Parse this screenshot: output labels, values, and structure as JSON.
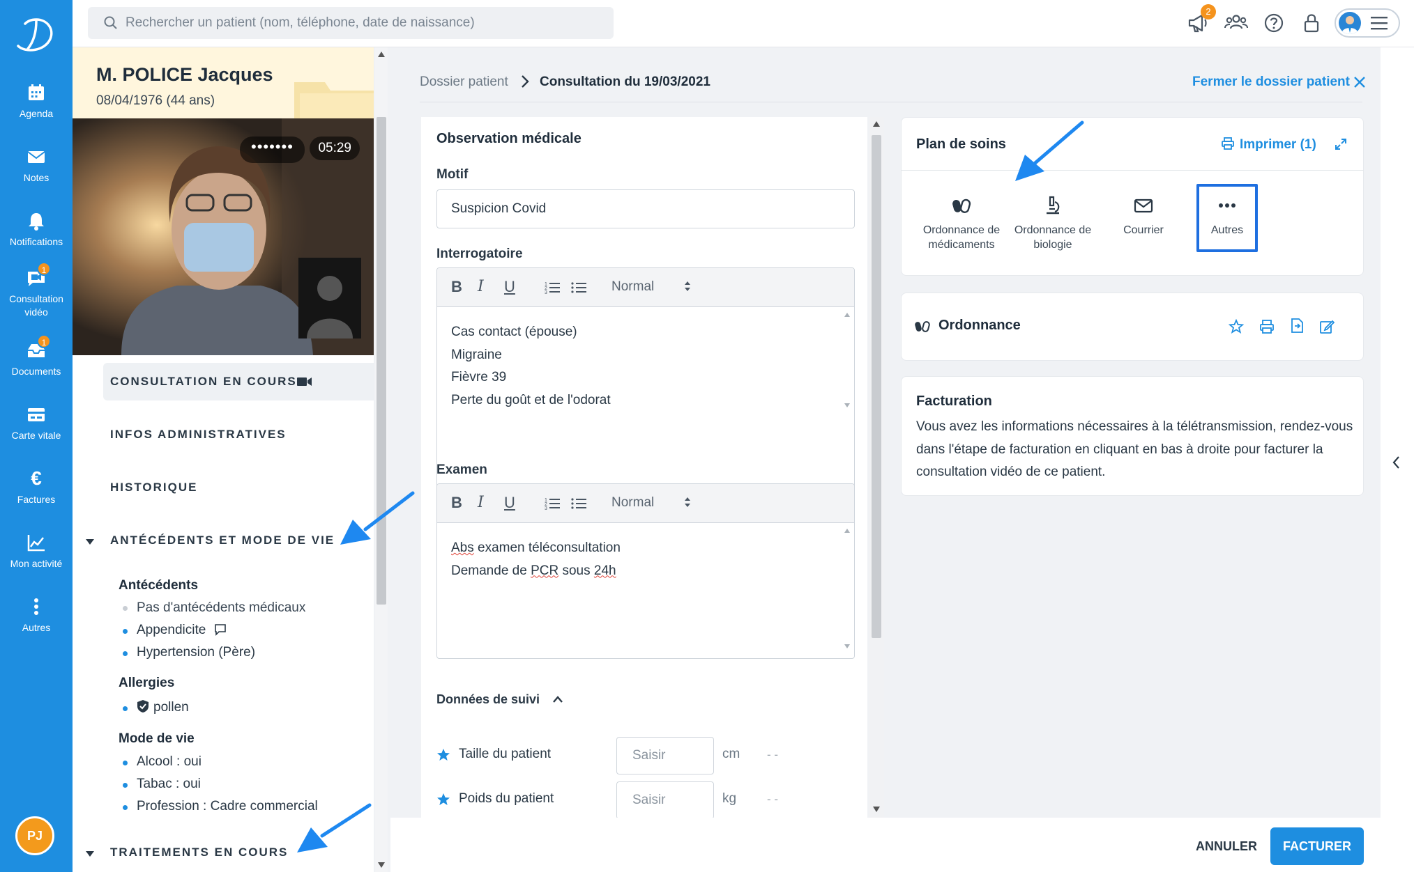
{
  "nav": {
    "items": [
      {
        "label": "Agenda",
        "icon": "calendar-icon"
      },
      {
        "label": "Notes",
        "icon": "envelope-icon"
      },
      {
        "label": "Notifications",
        "icon": "bell-icon"
      },
      {
        "label": "Consultation vidéo",
        "icon": "video-chat-icon",
        "badge": "1"
      },
      {
        "label": "Documents",
        "icon": "inbox-icon",
        "badge": "1"
      },
      {
        "label": "Carte vitale",
        "icon": "card-icon"
      },
      {
        "label": "Factures",
        "icon": "euro-icon",
        "glyph": "€"
      },
      {
        "label": "Mon activité",
        "icon": "chart-icon"
      },
      {
        "label": "Autres",
        "icon": "more-vertical-icon"
      }
    ],
    "user_initials": "PJ"
  },
  "topbar": {
    "search_placeholder": "Rechercher un patient (nom, téléphone, date de naissance)",
    "megaphone_badge": "2"
  },
  "patient": {
    "name": "M. POLICE Jacques",
    "dob": "08/04/1976 (44 ans)",
    "video_timer": "05:29",
    "video_dots": "•••••••"
  },
  "sections": {
    "consultation": "CONSULTATION EN COURS",
    "infos": "INFOS ADMINISTRATIVES",
    "historique": "HISTORIQUE",
    "antecedents": "ANTÉCÉDENTS ET MODE DE VIE",
    "traitements": "TRAITEMENTS EN COURS"
  },
  "antecedents": {
    "title": "Antécédents",
    "items": [
      "Pas d'antécédents médicaux",
      "Appendicite",
      "Hypertension (Père)"
    ],
    "allergies_title": "Allergies",
    "allergies": [
      "pollen"
    ],
    "mode_title": "Mode de vie",
    "mode": [
      "Alcool : oui",
      "Tabac : oui",
      "Profession : Cadre commercial"
    ]
  },
  "breadcrumb": {
    "root": "Dossier patient",
    "current": "Consultation du 19/03/2021",
    "close": "Fermer le dossier patient"
  },
  "observation": {
    "title": "Observation médicale",
    "motif_label": "Motif",
    "motif_value": "Suspicion Covid",
    "interrogatoire_label": "Interrogatoire",
    "interrogatoire_lines": [
      "Cas contact (épouse)",
      "Migraine",
      "Fièvre 39",
      "Perte du goût et de l'odorat"
    ],
    "examen_label": "Examen",
    "examen_line1_a": "Abs",
    "examen_line1_b": " examen téléconsultation",
    "examen_line2_a": "Demande de ",
    "examen_line2_b": "PCR",
    "examen_line2_c": " sous ",
    "examen_line2_d": "24h",
    "toolbar_select": "Normal",
    "suivi_label": "Données de suivi",
    "suivi_rows": [
      {
        "label": "Taille du patient",
        "placeholder": "Saisir",
        "unit": "cm",
        "dash": "- -"
      },
      {
        "label": "Poids du patient",
        "placeholder": "Saisir",
        "unit": "kg",
        "dash": "- -"
      }
    ]
  },
  "plan": {
    "title": "Plan de soins",
    "print": "Imprimer (1)",
    "actions": [
      {
        "label": "Ordonnance de médicaments",
        "icon": "pills-icon"
      },
      {
        "label": "Ordonnance de biologie",
        "icon": "microscope-icon"
      },
      {
        "label": "Courrier",
        "icon": "envelope-icon"
      },
      {
        "label": "Autres",
        "icon": "more-horizontal-icon"
      }
    ]
  },
  "ordonnance": {
    "title": "Ordonnance"
  },
  "facturation": {
    "title": "Facturation",
    "text": "Vous avez les informations nécessaires à la télétransmission, rendez-vous dans l'étape de facturation en cliquant en bas à droite pour facturer la consultation vidéo de ce patient."
  },
  "footer": {
    "cancel": "ANNULER",
    "bill": "FACTURER"
  },
  "colors": {
    "accent": "#1e8ee0",
    "badge": "#f5931d",
    "patient_header": "#fff6dd"
  }
}
